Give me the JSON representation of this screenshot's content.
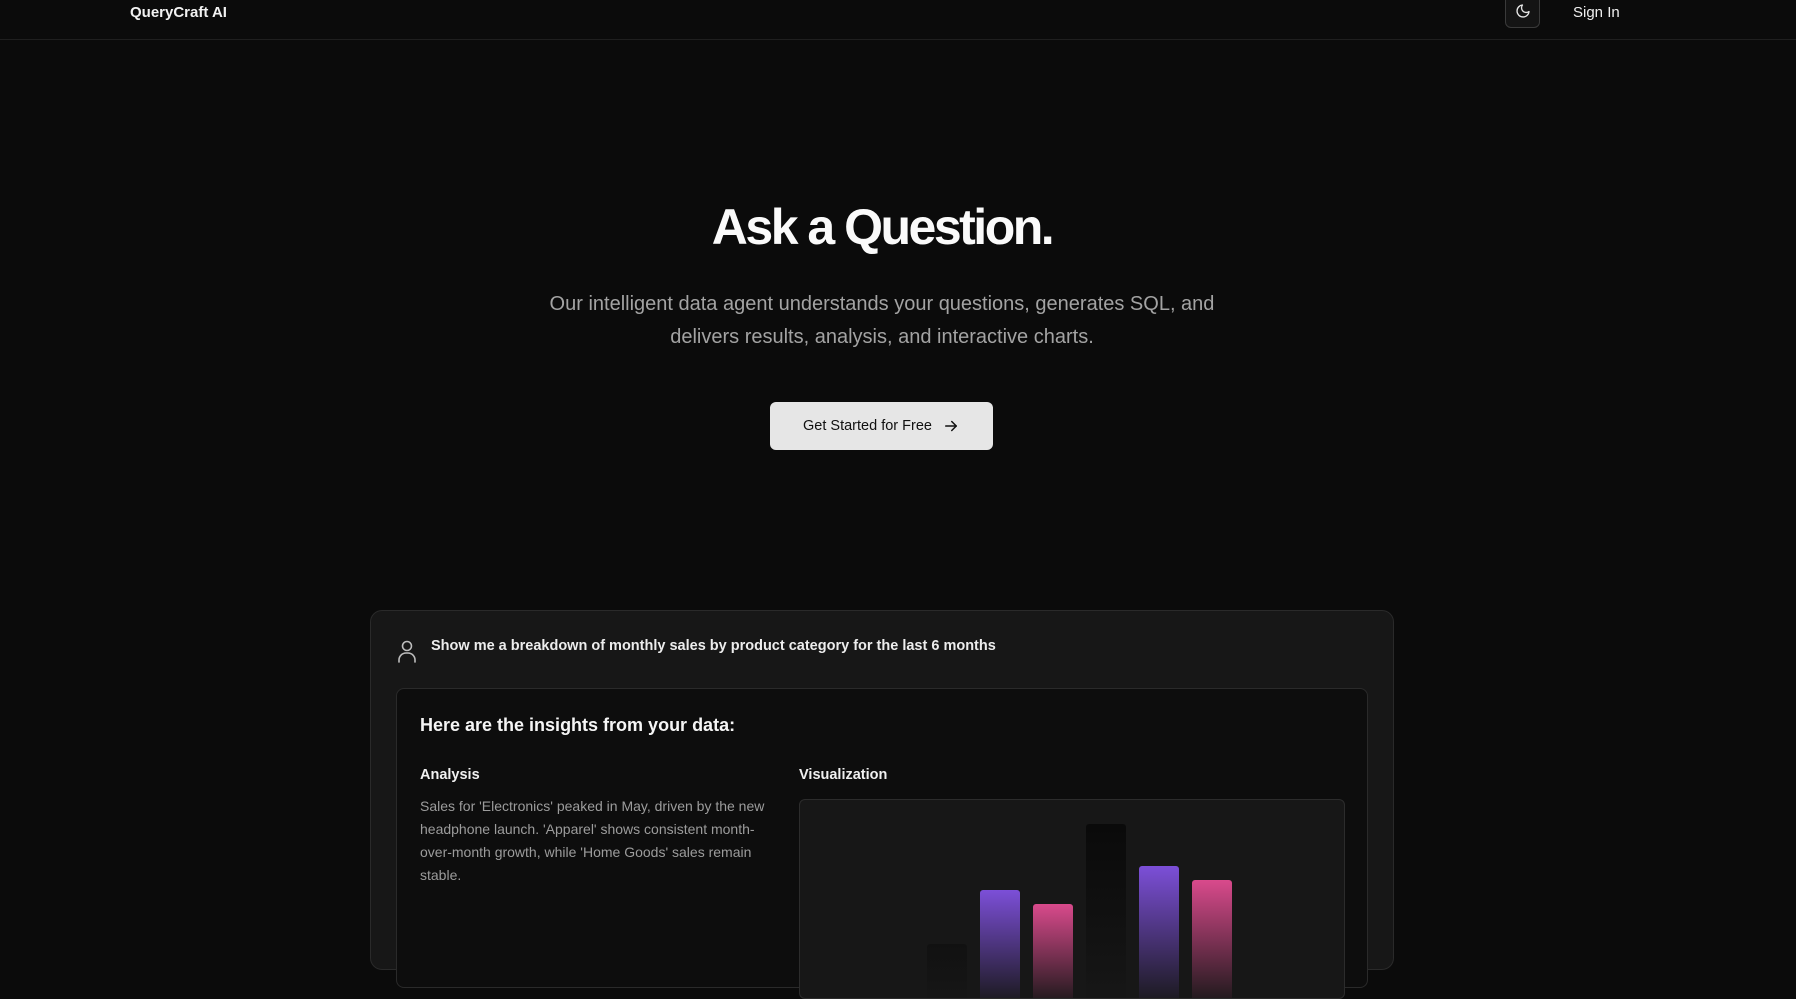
{
  "nav": {
    "brand": "QueryCraft AI",
    "theme_icon": "moon-icon",
    "sign_in": "Sign In"
  },
  "hero": {
    "title": "Ask a Question.",
    "subtitle": "Our intelligent data agent understands your questions, generates SQL, and delivers results, analysis, and interactive charts.",
    "cta_label": "Get Started for Free",
    "cta_icon": "arrow-right-icon"
  },
  "demo": {
    "user_icon": "user-icon",
    "user_question": "Show me a breakdown of monthly sales by product category for the last 6 months",
    "insights_title": "Here are the insights from your data:",
    "analysis_heading": "Analysis",
    "analysis_text": "Sales for 'Electronics' peaked in May, driven by the new headphone launch. 'Apparel' shows consistent month-over-month growth, while 'Home Goods' sales remain stable.",
    "visualization_heading": "Visualization"
  },
  "chart_data": {
    "type": "bar",
    "values": [
      28,
      55,
      48,
      88,
      67,
      60
    ],
    "colors": [
      "#111111",
      "#7c4fd8",
      "#d94a8c",
      "#0a0a0a",
      "#7c4fd8",
      "#d94a8c"
    ]
  }
}
